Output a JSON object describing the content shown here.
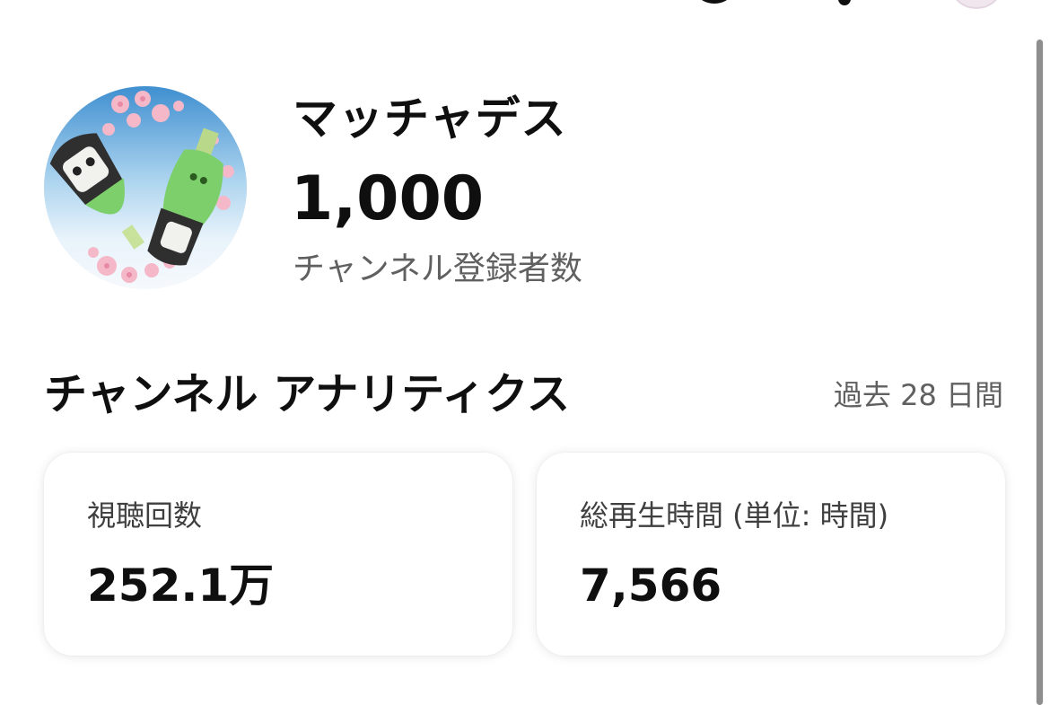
{
  "channel": {
    "name": "マッチャデス",
    "subscriber_count": "1,000",
    "subscriber_label": "チャンネル登録者数"
  },
  "analytics": {
    "title": "チャンネル アナリティクス",
    "period": "過去 28 日間",
    "cards": [
      {
        "label": "視聴回数",
        "value": "252.1万"
      },
      {
        "label": "総再生時間 (単位: 時間)",
        "value": "7,566"
      }
    ]
  },
  "icons": {
    "top_left": "account-circle-icon",
    "top_middle": "notification-icon",
    "top_right": "profile-avatar"
  },
  "colors": {
    "text_primary": "#0f0f0f",
    "text_secondary": "#606060",
    "card_background": "#ffffff"
  }
}
